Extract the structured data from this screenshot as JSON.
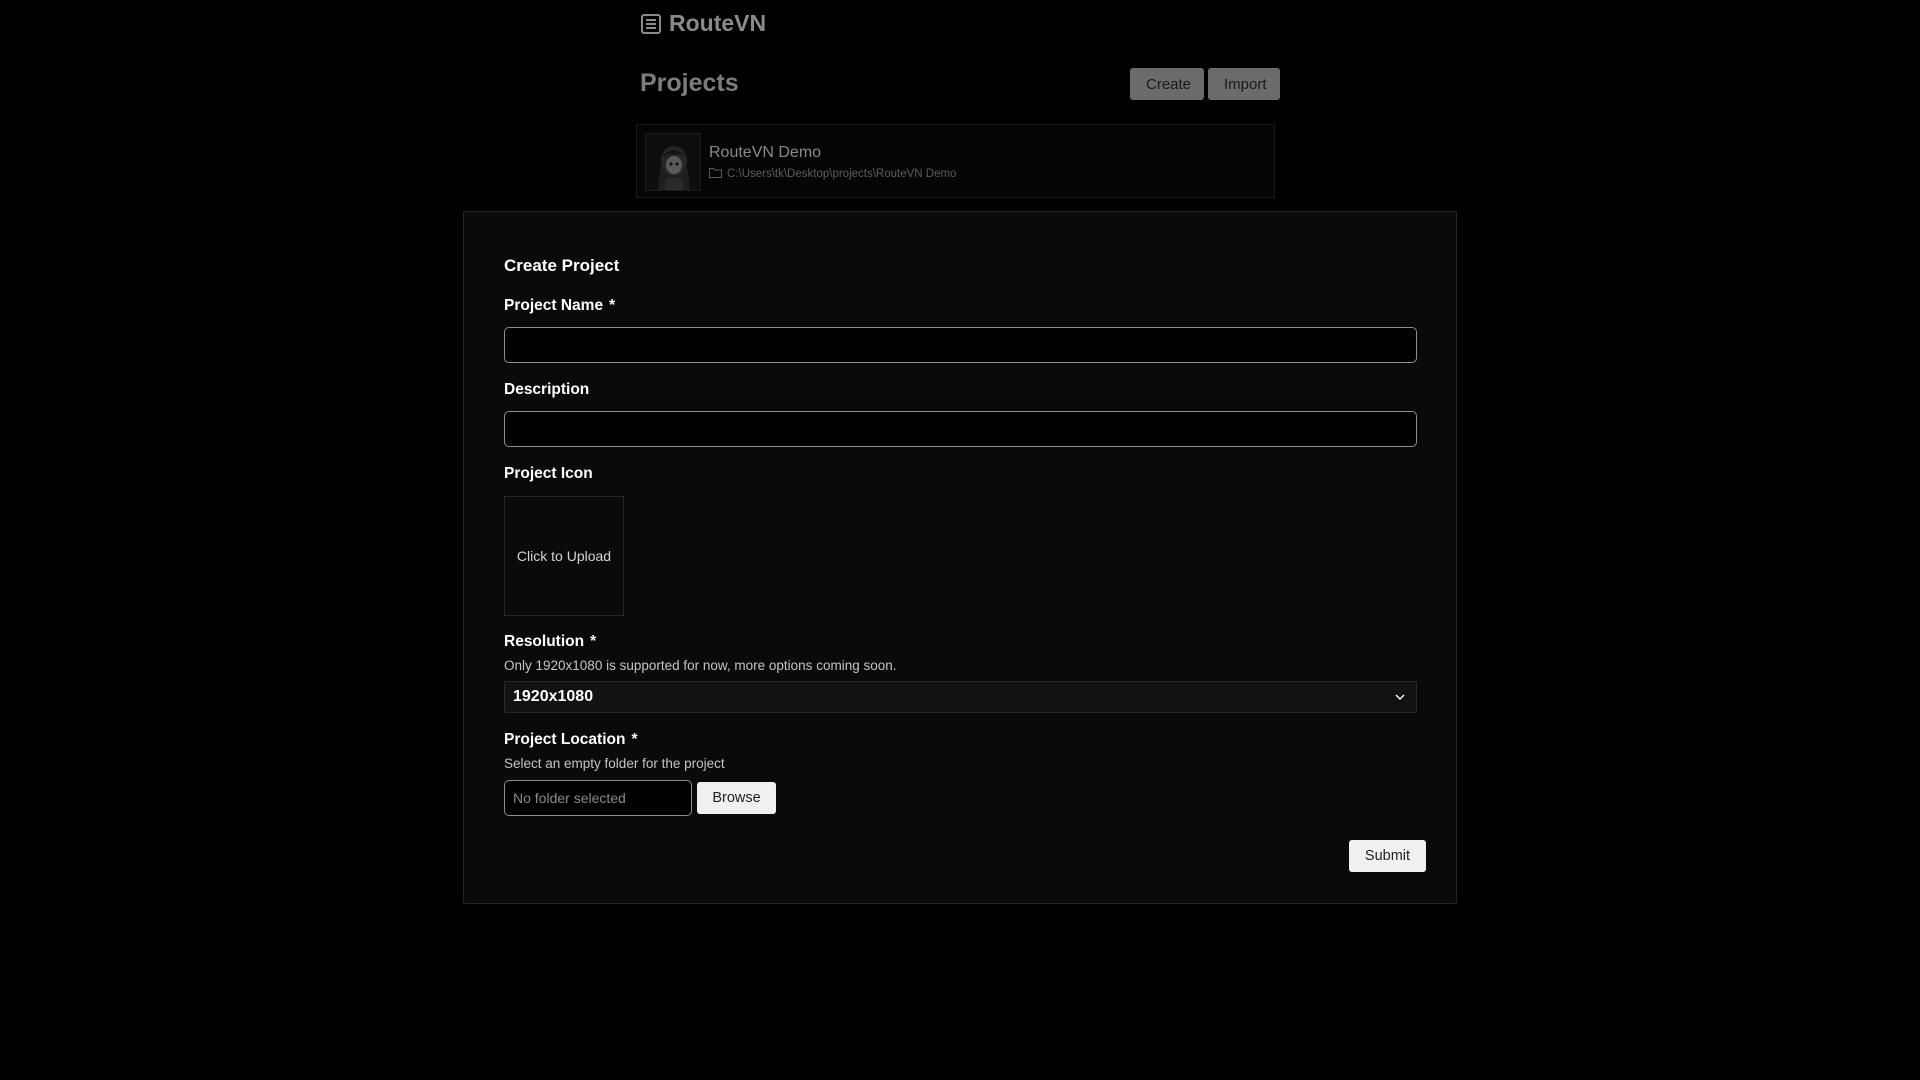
{
  "app": {
    "name": "RouteVN",
    "logo_icon": "document-lines-icon"
  },
  "projects_page": {
    "title": "Projects",
    "create_label": "Create",
    "import_label": "Import",
    "projects": [
      {
        "name": "RouteVN Demo",
        "path": "C:\\Users\\tk\\Desktop\\projects\\RouteVN Demo",
        "path_icon": "folder-icon",
        "thumbnail": "character-avatar"
      }
    ]
  },
  "modal": {
    "title": "Create Project",
    "fields": {
      "project_name": {
        "label": "Project Name",
        "required_mark": "*",
        "value": ""
      },
      "description": {
        "label": "Description",
        "value": ""
      },
      "project_icon": {
        "label": "Project Icon",
        "upload_text": "Click to Upload"
      },
      "resolution": {
        "label": "Resolution",
        "required_mark": "*",
        "help": "Only 1920x1080 is supported for now, more options coming soon.",
        "selected": "1920x1080",
        "dropdown_icon": "chevron-down-icon"
      },
      "project_location": {
        "label": "Project Location",
        "required_mark": "*",
        "help": "Select an empty folder for the project",
        "placeholder": "No folder selected",
        "browse_label": "Browse"
      }
    },
    "submit_label": "Submit"
  },
  "colors": {
    "background": "#000000",
    "modal_background": "#0a0a0a",
    "input_border": "#8f8f8f",
    "light_button": "#f0f0f0",
    "dimmed_button": "#6b6b6b"
  }
}
